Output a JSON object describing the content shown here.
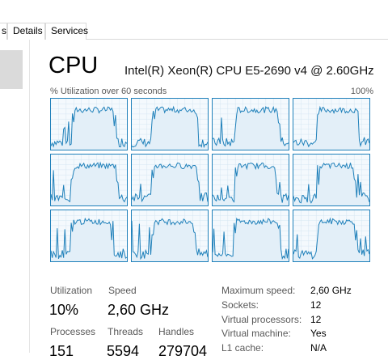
{
  "tabs": [
    {
      "label": "s"
    },
    {
      "label": "Details"
    },
    {
      "label": "Services"
    }
  ],
  "cpu": {
    "title": "CPU",
    "model": "Intel(R) Xeon(R) CPU E5-2690 v4 @ 2.60GHz",
    "graph_label": "% Utilization over 60 seconds",
    "graph_max": "100%",
    "core_graph_count": 12
  },
  "stats": {
    "utilization": {
      "label": "Utilization",
      "value": "10%"
    },
    "speed": {
      "label": "Speed",
      "value": "2,60 GHz"
    },
    "processes": {
      "label": "Processes",
      "value": "151"
    },
    "threads": {
      "label": "Threads",
      "value": "5594"
    },
    "handles": {
      "label": "Handles",
      "value": "279704"
    }
  },
  "specs": [
    {
      "label": "Maximum speed:",
      "value": "2,60 GHz"
    },
    {
      "label": "Sockets:",
      "value": "12"
    },
    {
      "label": "Virtual processors:",
      "value": "12"
    },
    {
      "label": "Virtual machine:",
      "value": "Yes"
    },
    {
      "label": "L1 cache:",
      "value": "N/A"
    }
  ],
  "colors": {
    "graph_line": "#1f80ba",
    "graph_fill": "#e3eff8",
    "graph_grid": "#d6e6f2"
  }
}
